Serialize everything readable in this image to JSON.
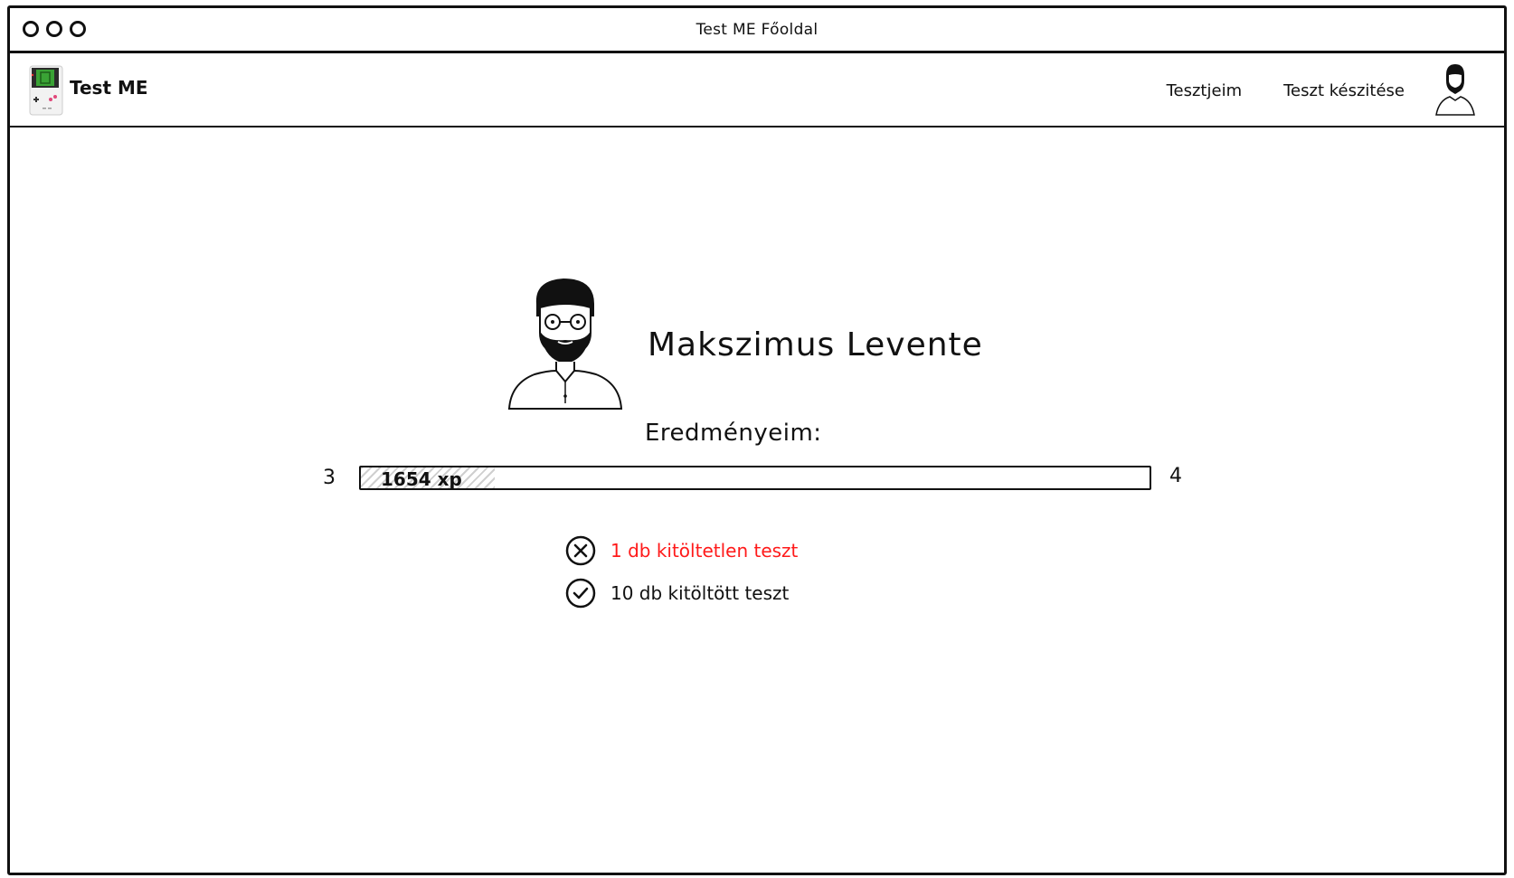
{
  "window": {
    "title": "Test ME Főoldal"
  },
  "navbar": {
    "brand": "Test ME",
    "links": [
      "Tesztjeim",
      "Teszt készitése"
    ]
  },
  "profile": {
    "name": "Makszimus Levente"
  },
  "results": {
    "label": "Eredményeim:",
    "level_current": "3",
    "level_next": "4",
    "xp_text": "1654 xp",
    "progress_fraction": 0.17
  },
  "stats": {
    "unfilled": "1 db kitöltetlen teszt",
    "filled": "10 db kitöltött teszt"
  },
  "colors": {
    "unfilled_text": "#ff1a1a",
    "logo_green": "#3aa335"
  }
}
